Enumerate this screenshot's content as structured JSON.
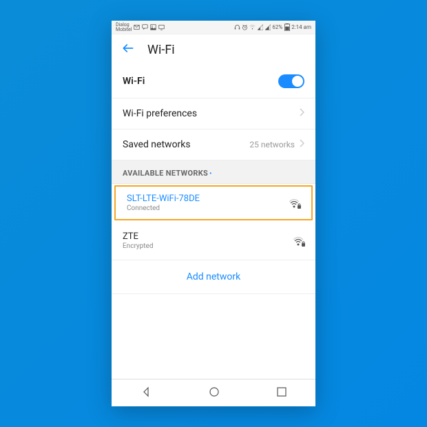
{
  "status_bar": {
    "carrier": "Dialog\nMobitel",
    "battery": "62%",
    "time": "2:14 am"
  },
  "header": {
    "title": "Wi-Fi"
  },
  "rows": {
    "wifi_toggle_label": "Wi-Fi",
    "preferences_label": "Wi-Fi preferences",
    "saved_label": "Saved networks",
    "saved_count": "25 networks"
  },
  "section_title": "AVAILABLE NETWORKS",
  "networks": [
    {
      "name": "SLT-LTE-WiFi-78DE",
      "status": "Connected",
      "highlighted": true
    },
    {
      "name": "ZTE",
      "status": "Encrypted",
      "highlighted": false
    }
  ],
  "add_network_label": "Add network"
}
